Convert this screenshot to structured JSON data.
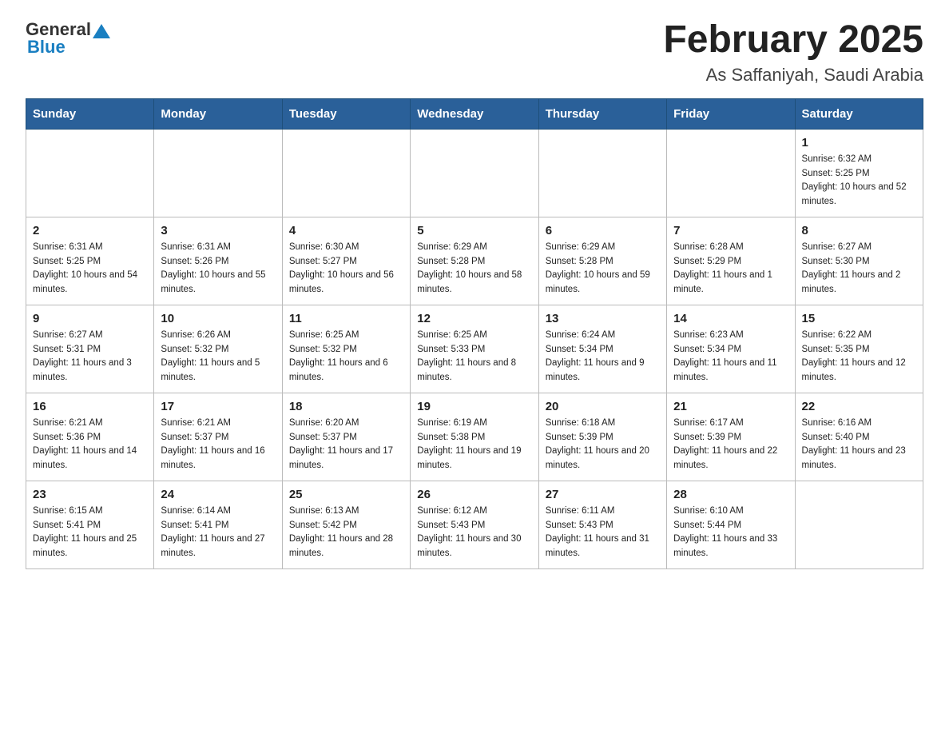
{
  "logo": {
    "general": "General",
    "blue": "Blue"
  },
  "title": "February 2025",
  "subtitle": "As Saffaniyah, Saudi Arabia",
  "days": [
    "Sunday",
    "Monday",
    "Tuesday",
    "Wednesday",
    "Thursday",
    "Friday",
    "Saturday"
  ],
  "weeks": [
    [
      {
        "day": "",
        "info": ""
      },
      {
        "day": "",
        "info": ""
      },
      {
        "day": "",
        "info": ""
      },
      {
        "day": "",
        "info": ""
      },
      {
        "day": "",
        "info": ""
      },
      {
        "day": "",
        "info": ""
      },
      {
        "day": "1",
        "info": "Sunrise: 6:32 AM\nSunset: 5:25 PM\nDaylight: 10 hours and 52 minutes."
      }
    ],
    [
      {
        "day": "2",
        "info": "Sunrise: 6:31 AM\nSunset: 5:25 PM\nDaylight: 10 hours and 54 minutes."
      },
      {
        "day": "3",
        "info": "Sunrise: 6:31 AM\nSunset: 5:26 PM\nDaylight: 10 hours and 55 minutes."
      },
      {
        "day": "4",
        "info": "Sunrise: 6:30 AM\nSunset: 5:27 PM\nDaylight: 10 hours and 56 minutes."
      },
      {
        "day": "5",
        "info": "Sunrise: 6:29 AM\nSunset: 5:28 PM\nDaylight: 10 hours and 58 minutes."
      },
      {
        "day": "6",
        "info": "Sunrise: 6:29 AM\nSunset: 5:28 PM\nDaylight: 10 hours and 59 minutes."
      },
      {
        "day": "7",
        "info": "Sunrise: 6:28 AM\nSunset: 5:29 PM\nDaylight: 11 hours and 1 minute."
      },
      {
        "day": "8",
        "info": "Sunrise: 6:27 AM\nSunset: 5:30 PM\nDaylight: 11 hours and 2 minutes."
      }
    ],
    [
      {
        "day": "9",
        "info": "Sunrise: 6:27 AM\nSunset: 5:31 PM\nDaylight: 11 hours and 3 minutes."
      },
      {
        "day": "10",
        "info": "Sunrise: 6:26 AM\nSunset: 5:32 PM\nDaylight: 11 hours and 5 minutes."
      },
      {
        "day": "11",
        "info": "Sunrise: 6:25 AM\nSunset: 5:32 PM\nDaylight: 11 hours and 6 minutes."
      },
      {
        "day": "12",
        "info": "Sunrise: 6:25 AM\nSunset: 5:33 PM\nDaylight: 11 hours and 8 minutes."
      },
      {
        "day": "13",
        "info": "Sunrise: 6:24 AM\nSunset: 5:34 PM\nDaylight: 11 hours and 9 minutes."
      },
      {
        "day": "14",
        "info": "Sunrise: 6:23 AM\nSunset: 5:34 PM\nDaylight: 11 hours and 11 minutes."
      },
      {
        "day": "15",
        "info": "Sunrise: 6:22 AM\nSunset: 5:35 PM\nDaylight: 11 hours and 12 minutes."
      }
    ],
    [
      {
        "day": "16",
        "info": "Sunrise: 6:21 AM\nSunset: 5:36 PM\nDaylight: 11 hours and 14 minutes."
      },
      {
        "day": "17",
        "info": "Sunrise: 6:21 AM\nSunset: 5:37 PM\nDaylight: 11 hours and 16 minutes."
      },
      {
        "day": "18",
        "info": "Sunrise: 6:20 AM\nSunset: 5:37 PM\nDaylight: 11 hours and 17 minutes."
      },
      {
        "day": "19",
        "info": "Sunrise: 6:19 AM\nSunset: 5:38 PM\nDaylight: 11 hours and 19 minutes."
      },
      {
        "day": "20",
        "info": "Sunrise: 6:18 AM\nSunset: 5:39 PM\nDaylight: 11 hours and 20 minutes."
      },
      {
        "day": "21",
        "info": "Sunrise: 6:17 AM\nSunset: 5:39 PM\nDaylight: 11 hours and 22 minutes."
      },
      {
        "day": "22",
        "info": "Sunrise: 6:16 AM\nSunset: 5:40 PM\nDaylight: 11 hours and 23 minutes."
      }
    ],
    [
      {
        "day": "23",
        "info": "Sunrise: 6:15 AM\nSunset: 5:41 PM\nDaylight: 11 hours and 25 minutes."
      },
      {
        "day": "24",
        "info": "Sunrise: 6:14 AM\nSunset: 5:41 PM\nDaylight: 11 hours and 27 minutes."
      },
      {
        "day": "25",
        "info": "Sunrise: 6:13 AM\nSunset: 5:42 PM\nDaylight: 11 hours and 28 minutes."
      },
      {
        "day": "26",
        "info": "Sunrise: 6:12 AM\nSunset: 5:43 PM\nDaylight: 11 hours and 30 minutes."
      },
      {
        "day": "27",
        "info": "Sunrise: 6:11 AM\nSunset: 5:43 PM\nDaylight: 11 hours and 31 minutes."
      },
      {
        "day": "28",
        "info": "Sunrise: 6:10 AM\nSunset: 5:44 PM\nDaylight: 11 hours and 33 minutes."
      },
      {
        "day": "",
        "info": ""
      }
    ]
  ]
}
